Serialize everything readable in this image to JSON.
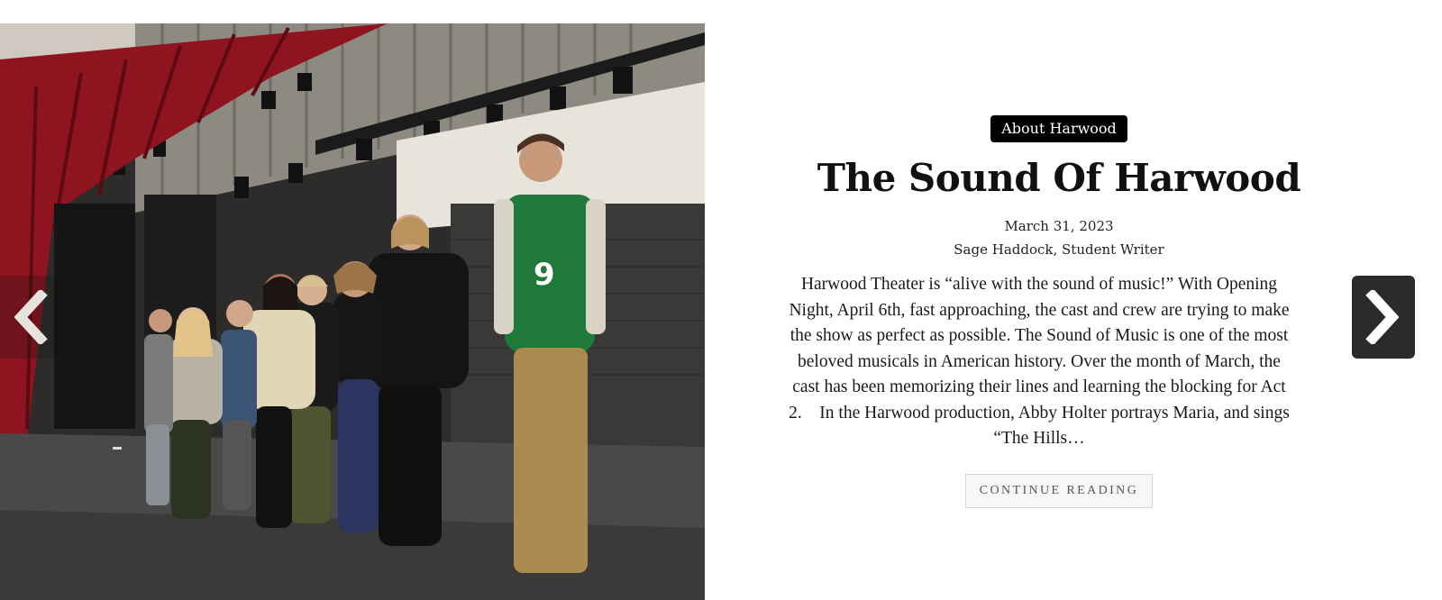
{
  "slide": {
    "image": {
      "alt": "Students singing on the Harwood Theater stage"
    },
    "category": "About Harwood",
    "title": "The Sound Of Harwood",
    "date": "March 31, 2023",
    "author": "Sage Haddock, Student Writer",
    "excerpt_lines": [
      "Harwood Theater is “alive with the sound of music!” With Opening",
      "Night, April 6th, fast approaching, the cast and crew are trying to make",
      "the show as perfect as possible. The Sound of Music is one of the most",
      "beloved musicals in American history.  Over the month of March, the",
      "cast has been memorizing their lines and learning the blocking for Act",
      "2.    In the Harwood production, Abby Holter portrays Maria, and sings",
      "“The Hills…"
    ],
    "cta_label": "CONTINUE READING"
  },
  "nav": {
    "prev_icon": "chevron-left-icon",
    "next_icon": "chevron-right-icon"
  },
  "colors": {
    "badge_bg": "#000000",
    "next_arrow_bg": "#2b2b2b",
    "curtain_red": "#8e1420"
  }
}
